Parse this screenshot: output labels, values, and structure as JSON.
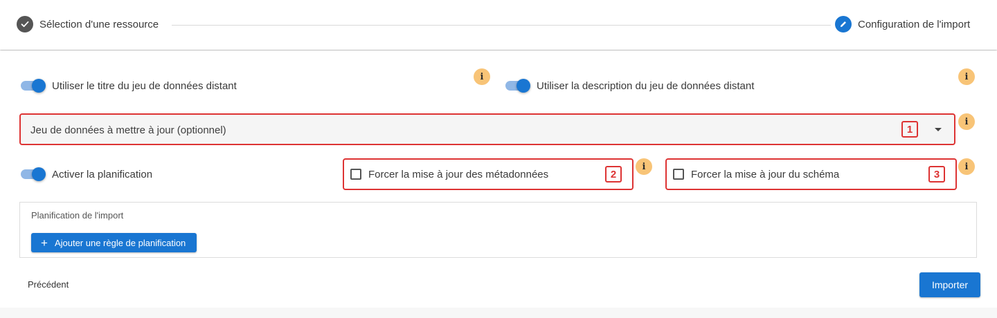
{
  "stepper": {
    "step1_label": "Sélection d'une ressource",
    "step2_label": "Configuration de l'import",
    "step1_state": "completed",
    "step2_state": "active",
    "step1_color": "#555555",
    "step2_color": "#1976d2"
  },
  "toggles": {
    "use_title_label": "Utiliser le titre du jeu de données distant",
    "use_title_on": true,
    "use_description_label": "Utiliser la description du jeu de données distant",
    "use_description_on": true,
    "schedule_label": "Activer la planification",
    "schedule_on": true
  },
  "info_icon_glyph": "i",
  "dataset_select": {
    "placeholder": "Jeu de données à mettre à jour (optionnel)",
    "annotation": "1"
  },
  "checkboxes": {
    "force_metadata_label": "Forcer la mise à jour des métadonnées",
    "force_metadata_checked": false,
    "force_metadata_annotation": "2",
    "force_schema_label": "Forcer la mise à jour du schéma",
    "force_schema_checked": false,
    "force_schema_annotation": "3"
  },
  "schedule_panel": {
    "title": "Planification de l'import",
    "add_rule_label": "Ajouter une règle de planification",
    "add_rule_icon": "plus-icon"
  },
  "footer": {
    "previous_label": "Précédent",
    "import_label": "Importer"
  },
  "colors": {
    "accent": "#1976d2",
    "annotation": "#dd3333",
    "info": "#f8c477"
  }
}
